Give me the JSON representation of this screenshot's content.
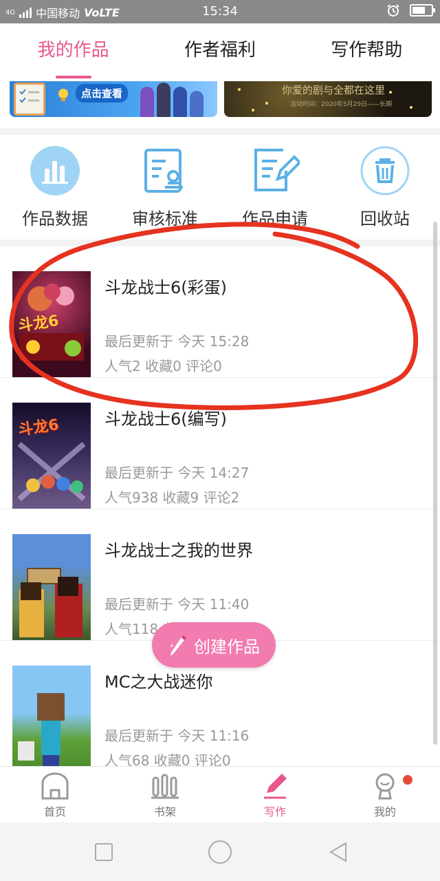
{
  "status_bar": {
    "network": "4G",
    "carrier": "中国移动",
    "volte": "VoLTE",
    "time": "15:34",
    "icons": [
      "signal-icon",
      "alarm-icon",
      "battery-charging-icon"
    ]
  },
  "top_tabs": [
    {
      "label": "我的作品",
      "active": true
    },
    {
      "label": "作者福利",
      "active": false
    },
    {
      "label": "写作帮助",
      "active": false
    }
  ],
  "banners": [
    {
      "button_text": "点击查看"
    },
    {
      "text": "你爱的剧与全都在这里",
      "subtext": "活动时间：2020年5月29日——长期"
    }
  ],
  "actions": [
    {
      "label": "作品数据",
      "icon": "bar-chart-icon"
    },
    {
      "label": "审核标准",
      "icon": "review-stamp-icon"
    },
    {
      "label": "作品申请",
      "icon": "edit-document-icon"
    },
    {
      "label": "回收站",
      "icon": "trash-icon"
    }
  ],
  "works": [
    {
      "title": "斗龙战士6(彩蛋)",
      "updated": "最后更新于 今天 15:28",
      "stats": "人气2  收藏0  评论0"
    },
    {
      "title": "斗龙战士6(编写)",
      "updated": "最后更新于 今天 14:27",
      "stats": "人气938  收藏9  评论2"
    },
    {
      "title": "斗龙战士之我的世界",
      "updated": "最后更新于 今天 11:40",
      "stats": "人气118  收藏"
    },
    {
      "title": "MC之大战迷你",
      "updated": "最后更新于 今天 11:16",
      "stats": "人气68  收藏0  评论0"
    }
  ],
  "fab": {
    "label": "创建作品",
    "icon": "pencil-icon"
  },
  "bottom_nav": [
    {
      "label": "首页",
      "icon": "home-icon",
      "active": false
    },
    {
      "label": "书架",
      "icon": "bookshelf-icon",
      "active": false
    },
    {
      "label": "写作",
      "icon": "write-pencil-icon",
      "active": true
    },
    {
      "label": "我的",
      "icon": "profile-icon",
      "active": false,
      "badge": true
    }
  ],
  "colors": {
    "accent": "#e8578f",
    "fab": "#f27bb0",
    "icon_blue": "#5bb0e6",
    "annotation": "#e53320"
  }
}
